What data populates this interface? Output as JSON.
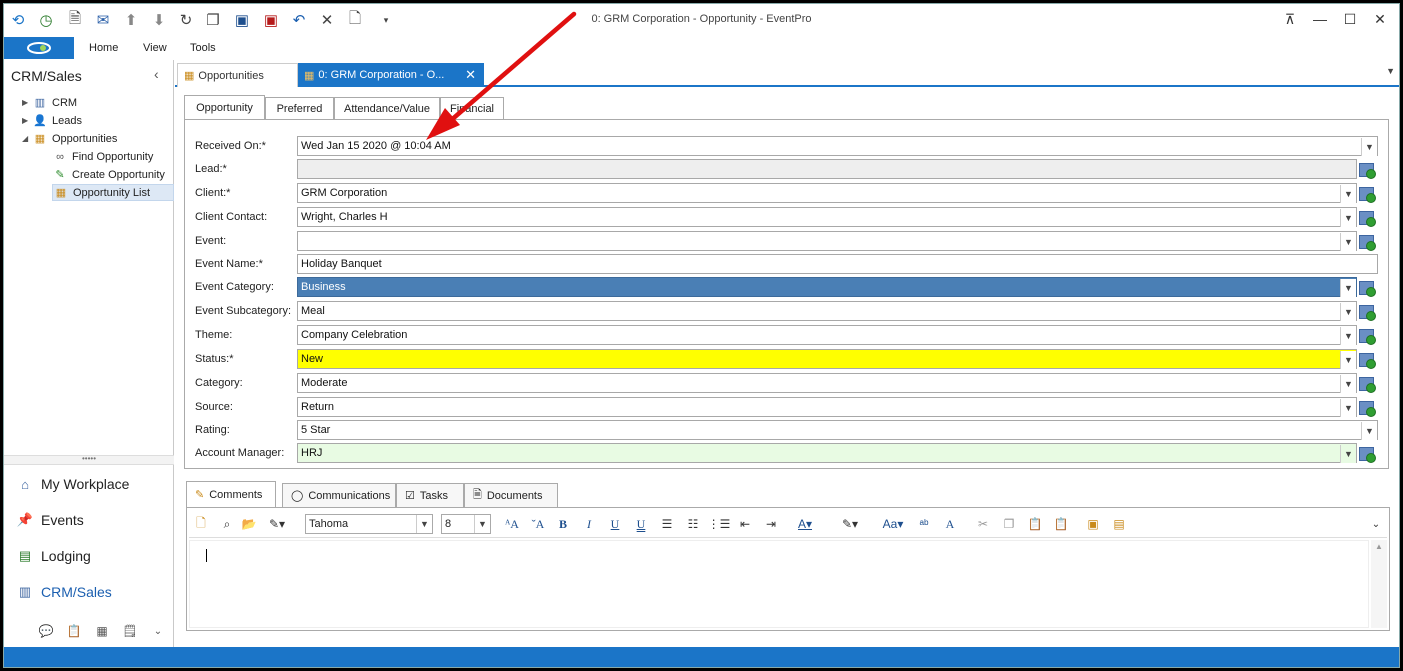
{
  "window": {
    "title": "0: GRM Corporation - Opportunity - EventPro"
  },
  "quick_access": [
    "back-forward-icon",
    "clock-icon",
    "document-icon",
    "mail-icon",
    "up-circle-icon",
    "down-circle-icon",
    "refresh-icon",
    "copy-icon",
    "save-icon",
    "save-close-icon",
    "undo-icon",
    "close-icon",
    "new-page-icon",
    "customize-dropdown-icon"
  ],
  "menu": {
    "home": "Home",
    "view": "View",
    "tools": "Tools"
  },
  "left": {
    "header": "CRM/Sales",
    "tree": [
      {
        "label": "CRM"
      },
      {
        "label": "Leads"
      },
      {
        "label": "Opportunities"
      },
      {
        "label": "Find Opportunity"
      },
      {
        "label": "Create Opportunity"
      },
      {
        "label": "Opportunity List"
      }
    ],
    "splitter": "•••••",
    "nav": [
      {
        "label": "My Workplace"
      },
      {
        "label": "Events"
      },
      {
        "label": "Lodging"
      },
      {
        "label": "CRM/Sales"
      }
    ]
  },
  "doc_tabs": [
    {
      "label": "Opportunities"
    },
    {
      "label": "0: GRM Corporation - O..."
    }
  ],
  "form_tabs": [
    "Opportunity",
    "Preferred",
    "Attendance/Value",
    "Financial"
  ],
  "fields": [
    {
      "label": "Received On:*",
      "value": "Wed Jan 15 2020 @ 10:04 AM"
    },
    {
      "label": "Lead:*",
      "value": ""
    },
    {
      "label": "Client:*",
      "value": "GRM Corporation"
    },
    {
      "label": "Client Contact:",
      "value": "Wright, Charles H"
    },
    {
      "label": "Event:",
      "value": ""
    },
    {
      "label": "Event Name:*",
      "value": "Holiday Banquet"
    },
    {
      "label": "Event Category:",
      "value": "Business"
    },
    {
      "label": "Event Subcategory:",
      "value": "Meal"
    },
    {
      "label": "Theme:",
      "value": "Company Celebration"
    },
    {
      "label": "Status:*",
      "value": "New"
    },
    {
      "label": "Category:",
      "value": "Moderate"
    },
    {
      "label": "Source:",
      "value": "Return"
    },
    {
      "label": "Rating:",
      "value": "5 Star"
    },
    {
      "label": "Account Manager:",
      "value": "HRJ"
    }
  ],
  "bottom_tabs": [
    "Comments",
    "Communications",
    "Tasks",
    "Documents"
  ],
  "editor": {
    "font": "Tahoma",
    "size": "8"
  },
  "colors": {
    "accent": "#1b75c8",
    "selected_field": "#4a7fb5",
    "status_field": "#ffff00",
    "manager_field": "#e8fbe3",
    "arrow": "#e01010"
  }
}
